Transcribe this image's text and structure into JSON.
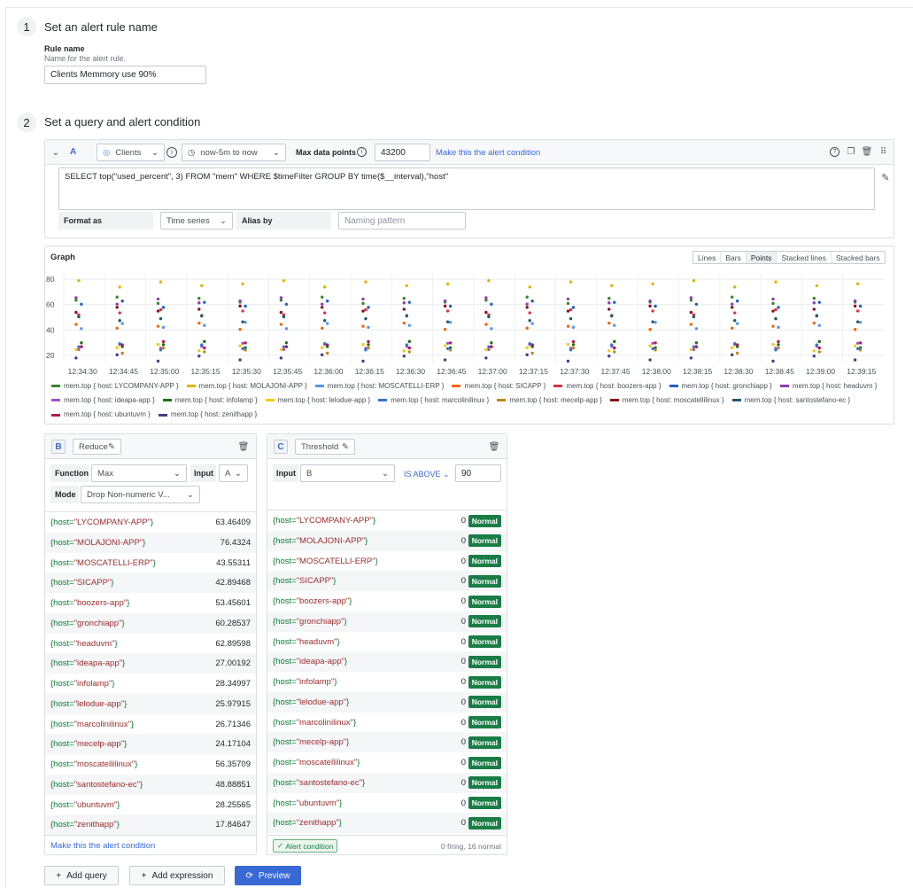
{
  "step1": {
    "num": "1",
    "title": "Set an alert rule name",
    "rule_label": "Rule name",
    "rule_help": "Name for the alert rule.",
    "rule_value": "Clients Memmory use 90%"
  },
  "step2": {
    "num": "2",
    "title": "Set a query and alert condition"
  },
  "query_a": {
    "letter": "A",
    "datasource": "Clients",
    "time_range": "now-5m to now",
    "max_points_label": "Max data points",
    "max_points_value": "43200",
    "make_condition": "Make this the alert condition",
    "sql": "SELECT top(\"used_percent\", 3) FROM \"mem\" WHERE $timeFilter GROUP BY time($__interval),\"host\"",
    "format_label": "Format as",
    "format_value": "Time series",
    "alias_label": "Alias by",
    "alias_placeholder": "Naming pattern"
  },
  "graph": {
    "title": "Graph",
    "modes": [
      "Lines",
      "Bars",
      "Points",
      "Stacked lines",
      "Stacked bars"
    ],
    "active_mode": "Points"
  },
  "chart_data": {
    "type": "scatter",
    "ylim": [
      15,
      85
    ],
    "yticks": [
      20,
      40,
      60,
      80
    ],
    "xticks": [
      "12:34:30",
      "12:34:45",
      "12:35:00",
      "12:35:15",
      "12:35:30",
      "12:35:45",
      "12:36:00",
      "12:36:15",
      "12:36:30",
      "12:36:45",
      "12:37:00",
      "12:37:15",
      "12:37:30",
      "12:37:45",
      "12:38:00",
      "12:38:15",
      "12:38:30",
      "12:38:45",
      "12:39:00",
      "12:39:15"
    ],
    "grid": true,
    "legend_placement": "bottom",
    "series": [
      {
        "name": "mem.top { host: LYCOMPANY-APP }",
        "color": "#37872d",
        "value": 63.46
      },
      {
        "name": "mem.top { host: MOLAJONI-APP }",
        "color": "#e0b400",
        "value": 76.43
      },
      {
        "name": "mem.top { host: MOSCATELLI-ERP }",
        "color": "#5794f2",
        "value": 43.55
      },
      {
        "name": "mem.top { host: SICAPP }",
        "color": "#fa6400",
        "value": 42.89
      },
      {
        "name": "mem.top { host: boozers-app }",
        "color": "#e02f44",
        "value": 53.46
      },
      {
        "name": "mem.top { host: gronchiapp }",
        "color": "#1f60c4",
        "value": 60.29
      },
      {
        "name": "mem.top { host: headuvm }",
        "color": "#8f3bb8",
        "value": 62.9
      },
      {
        "name": "mem.top { host: ideapa-app }",
        "color": "#a352cc",
        "value": 27.0
      },
      {
        "name": "mem.top { host: infolamp }",
        "color": "#19730e",
        "value": 28.35
      },
      {
        "name": "mem.top { host: lelodue-app }",
        "color": "#f2cc0c",
        "value": 25.98
      },
      {
        "name": "mem.top { host: marcolinilinux }",
        "color": "#3274d9",
        "value": 26.71
      },
      {
        "name": "mem.top { host: mecelp-app }",
        "color": "#c4841d",
        "value": 24.17
      },
      {
        "name": "mem.top { host: moscatellilinux }",
        "color": "#8a0e1a",
        "value": 56.36
      },
      {
        "name": "mem.top { host: santostefano-ec }",
        "color": "#1e5a6e",
        "value": 48.89
      },
      {
        "name": "mem.top { host: ubuntuvm }",
        "color": "#b5174f",
        "value": 28.26
      },
      {
        "name": "mem.top { host: zenithapp }",
        "color": "#4a3a8c",
        "value": 17.85
      }
    ]
  },
  "expr_b": {
    "letter": "B",
    "type": "Reduce",
    "function_label": "Function",
    "function_value": "Max",
    "input_label": "Input",
    "input_value": "A",
    "mode_label": "Mode",
    "mode_value": "Drop Non-numeric V...",
    "rows": [
      {
        "key": "{host=",
        "val": "\"LYCOMPANY-APP\"",
        "end": "}",
        "num": "63.46409"
      },
      {
        "key": "{host=",
        "val": "\"MOLAJONI-APP\"",
        "end": "}",
        "num": "76.4324"
      },
      {
        "key": "{host=",
        "val": "\"MOSCATELLI-ERP\"",
        "end": "}",
        "num": "43.55311"
      },
      {
        "key": "{host=",
        "val": "\"SICAPP\"",
        "end": "}",
        "num": "42.89468"
      },
      {
        "key": "{host=",
        "val": "\"boozers-app\"",
        "end": "}",
        "num": "53.45601"
      },
      {
        "key": "{host=",
        "val": "\"gronchiapp\"",
        "end": "}",
        "num": "60.28537"
      },
      {
        "key": "{host=",
        "val": "\"headuvm\"",
        "end": "}",
        "num": "62.89598"
      },
      {
        "key": "{host=",
        "val": "\"ideapa-app\"",
        "end": "}",
        "num": "27.00192"
      },
      {
        "key": "{host=",
        "val": "\"infolamp\"",
        "end": "}",
        "num": "28.34997"
      },
      {
        "key": "{host=",
        "val": "\"lelodue-app\"",
        "end": "}",
        "num": "25.97915"
      },
      {
        "key": "{host=",
        "val": "\"marcolinilinux\"",
        "end": "}",
        "num": "26.71346"
      },
      {
        "key": "{host=",
        "val": "\"mecelp-app\"",
        "end": "}",
        "num": "24.17104"
      },
      {
        "key": "{host=",
        "val": "\"moscatellilinux\"",
        "end": "}",
        "num": "56.35709"
      },
      {
        "key": "{host=",
        "val": "\"santostefano-ec\"",
        "end": "}",
        "num": "48.88851"
      },
      {
        "key": "{host=",
        "val": "\"ubuntuvm\"",
        "end": "}",
        "num": "28.25565"
      },
      {
        "key": "{host=",
        "val": "\"zenithapp\"",
        "end": "}",
        "num": "17.84647"
      }
    ],
    "make_condition": "Make this the alert condition"
  },
  "expr_c": {
    "letter": "C",
    "type": "Threshold",
    "input_label": "Input",
    "input_value": "B",
    "op": "IS ABOVE",
    "threshold": "90",
    "result_value": "0",
    "badge": "Normal",
    "alert_condition": "Alert condition",
    "summary": "0 firing, 16 normal"
  },
  "buttons": {
    "add_query": "Add query",
    "add_expression": "Add expression",
    "preview": "Preview"
  }
}
